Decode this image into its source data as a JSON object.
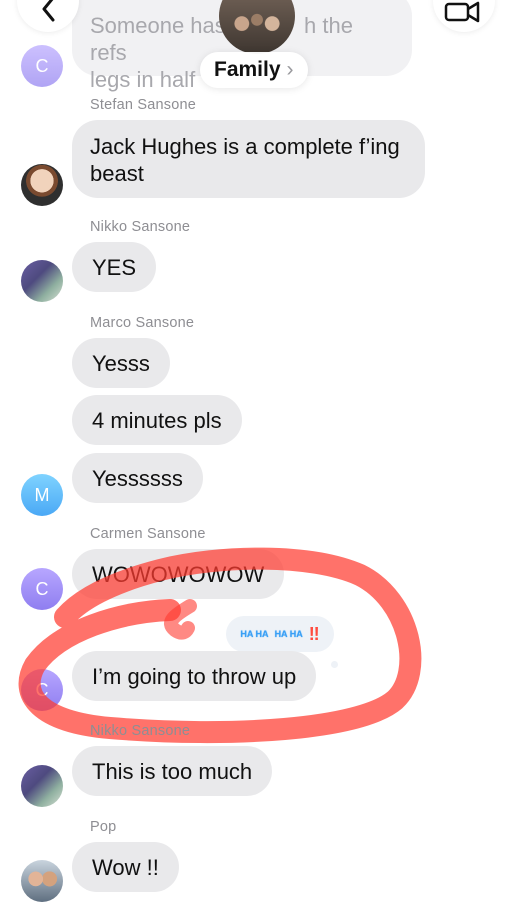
{
  "header": {
    "back_icon": "chevron-left-icon",
    "video_icon": "video-camera-icon",
    "group_name": "Family",
    "group_chevron": "›"
  },
  "messages": [
    {
      "sender": "",
      "text": "Someone has ... the refs legs in half",
      "avatar": "C",
      "faded": true
    },
    {
      "sender": "Stefan Sansone",
      "text": "Jack Hughes is a complete f’ing beast",
      "avatar": "photo"
    },
    {
      "sender": "Nikko Sansone",
      "text": "YES",
      "avatar": "photo"
    },
    {
      "sender": "Marco Sansone",
      "text": "Yesss",
      "avatar": ""
    },
    {
      "sender": "",
      "text": "4 minutes pls",
      "avatar": ""
    },
    {
      "sender": "",
      "text": "Yessssss",
      "avatar": "M"
    },
    {
      "sender": "Carmen Sansone",
      "text": "WOWOWOWOW",
      "avatar": "C"
    },
    {
      "sender": "",
      "text": "I’m going to throw up",
      "avatar": "C",
      "reactions": [
        "haha",
        "haha",
        "!!"
      ]
    },
    {
      "sender": "Nikko Sansone",
      "text": "This is too much",
      "avatar": "photo"
    },
    {
      "sender": "Pop",
      "text": "Wow !!",
      "avatar": "photo"
    }
  ],
  "faded_top": {
    "line1_left": "Someone has",
    "line1_right": "h the refs",
    "line2": "legs in half"
  },
  "reactions": {
    "haha_text": "HA HA",
    "exclaim_text": "‼"
  },
  "colors": {
    "bubble": "#e9e9eb",
    "sender": "#8e8e93",
    "annotation": "#ff3b30"
  }
}
